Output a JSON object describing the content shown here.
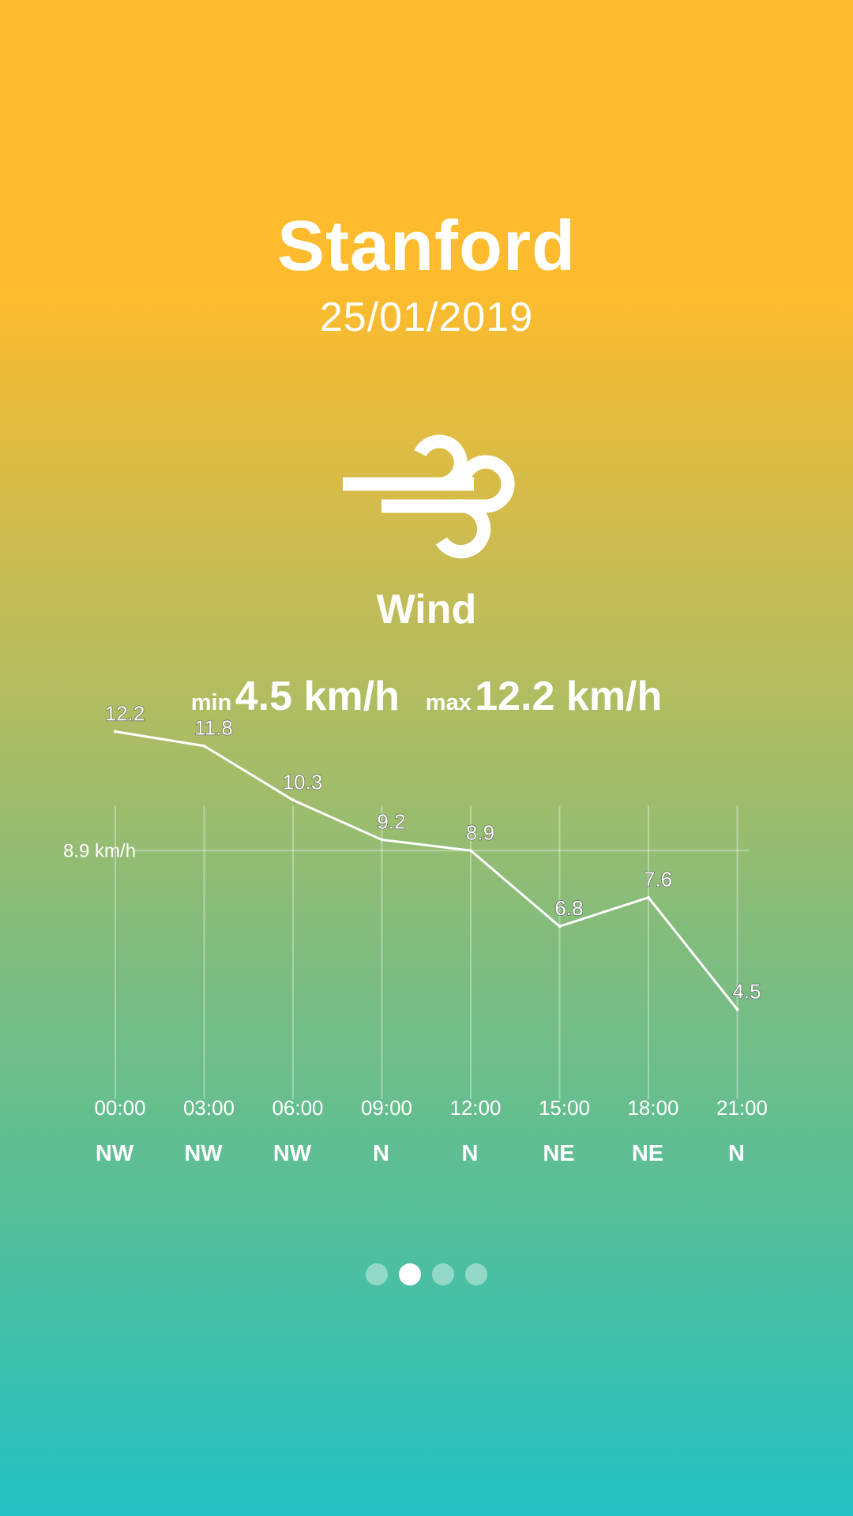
{
  "header": {
    "city": "Stanford",
    "date": "25/01/2019"
  },
  "condition": {
    "icon": "wind-icon",
    "label": "Wind"
  },
  "summary": {
    "min_label": "min",
    "min_value": "4.5 km/h",
    "max_label": "max",
    "max_value": "12.2 km/h"
  },
  "chart_data": {
    "type": "line",
    "x": [
      "00:00",
      "03:00",
      "06:00",
      "09:00",
      "12:00",
      "15:00",
      "18:00",
      "21:00"
    ],
    "values": [
      12.2,
      11.8,
      10.3,
      9.2,
      8.9,
      6.8,
      7.6,
      4.5
    ],
    "labels": [
      "12.2",
      "11.8",
      "10.3",
      "9.2",
      "8.9",
      "6.8",
      "7.6",
      "4.5"
    ],
    "directions": [
      "NW",
      "NW",
      "NW",
      "N",
      "N",
      "NE",
      "NE",
      "N"
    ],
    "average_line_value": 8.9,
    "average_line_label": "8.9 km/h",
    "grid": true,
    "line_color": "#ffffff"
  },
  "pager": {
    "count": 4,
    "active_index": 1
  },
  "colors": {
    "gradient_top": "#fdbb2d",
    "gradient_bottom": "#22c1c3",
    "text": "#ffffff"
  }
}
